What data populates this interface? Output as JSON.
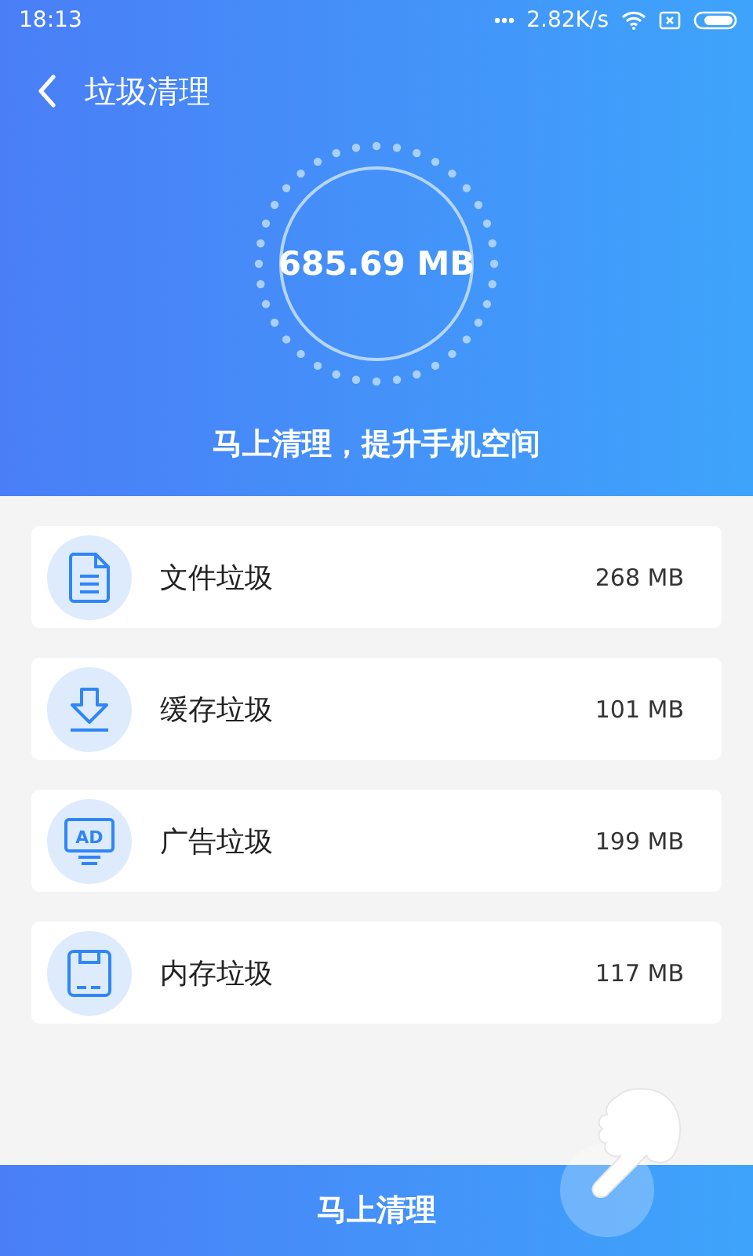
{
  "status_bar": {
    "time": "18:13",
    "speed": "2.82K/s"
  },
  "header": {
    "title": "垃圾清理",
    "total": "685.69 MB",
    "subtitle": "马上清理，提升手机空间"
  },
  "items": [
    {
      "kind": "file",
      "label": "文件垃圾",
      "size": "268 MB"
    },
    {
      "kind": "download",
      "label": "缓存垃圾",
      "size": "101 MB"
    },
    {
      "kind": "ad",
      "icon_text": "AD",
      "label": "广告垃圾",
      "size": "199 MB"
    },
    {
      "kind": "disk",
      "label": "内存垃圾",
      "size": "117 MB"
    }
  ],
  "action_button": {
    "label": "马上清理"
  }
}
